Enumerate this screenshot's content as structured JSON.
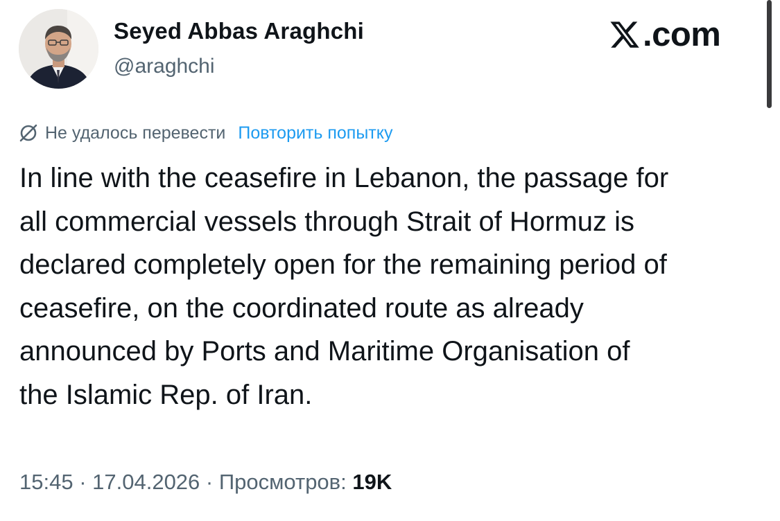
{
  "author": {
    "display_name": "Seyed Abbas Araghchi",
    "handle": "@araghchi"
  },
  "brand": {
    "text": ".com",
    "icon": "x-logo-icon"
  },
  "translation": {
    "icon": "no-translate-icon",
    "status": "Не удалось перевести",
    "retry_label": "Повторить попытку"
  },
  "tweet": {
    "lines": [
      "In line with the ceasefire in Lebanon, the passage for",
      "all commercial vessels through Strait of Hormuz is",
      "declared completely open for the remaining period of",
      "ceasefire, on the coordinated route as already",
      "announced by Ports and Maritime Organisation of",
      "the Islamic Rep. of Iran."
    ]
  },
  "meta": {
    "time": "15:45",
    "separator": " · ",
    "date": "17.04.2026",
    "views_label": "Просмотров:",
    "views_count": "19K"
  },
  "colors": {
    "text_primary": "#0f1419",
    "text_secondary": "#536471",
    "link": "#1d9bf0",
    "background": "#ffffff"
  }
}
